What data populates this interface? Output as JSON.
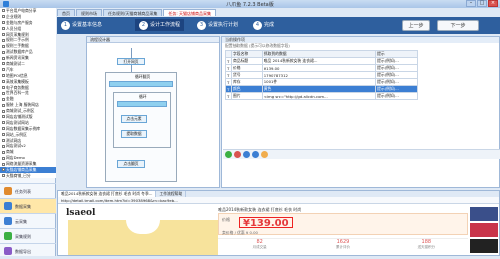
{
  "window": {
    "title": "八爪鱼 7.2.3 Beta版"
  },
  "tabs": [
    {
      "label": "首页",
      "active": false
    },
    {
      "label": "规则市场",
      "active": false
    },
    {
      "label": "任务规则/天猫商城商品采集",
      "active": false
    },
    {
      "label": "任务: 天猫店铺商品采集",
      "active": true
    }
  ],
  "wizard": {
    "steps": [
      {
        "num": "1",
        "label": "设置基本信息"
      },
      {
        "num": "2",
        "label": "设计工作流程"
      },
      {
        "num": "3",
        "label": "设置执行计划"
      },
      {
        "num": "4",
        "label": "完成"
      }
    ],
    "prev_label": "上一步",
    "next_label": "下一步"
  },
  "sidebar": {
    "tree": [
      "平台用户电商分享",
      "企业规则",
      "金融与房产服务",
      "人员分组",
      "网页采集规则",
      "规则二手示例",
      "规则三手数据",
      "测试数据库产品",
      "新闻资讯采集",
      "商城测试二",
      "汽车",
      "地图POI信息",
      "高效采集模板",
      "电子商务数据",
      "世界百科一览",
      "金融",
      "服装 上海 服装网店",
      "商城测试_示例区",
      "网店店铺测试版",
      "网店测试网站",
      "网店数据采集示例库",
      "网站_示例区",
      "测试网店",
      "网店测试v2",
      "商城",
      "网店Demo",
      "网络流量资源采集",
      "天猫店铺商品采集",
      "天猫商铺_已分",
      "天猫店铺商品采集_1"
    ],
    "selected_index": 27,
    "modules": [
      {
        "label": "任务列表",
        "active": false
      },
      {
        "label": "数据采集",
        "active": true
      },
      {
        "label": "云采集",
        "active": false
      },
      {
        "label": "采集规则",
        "active": false
      },
      {
        "label": "数据导出",
        "active": false
      }
    ]
  },
  "designer": {
    "header": "流程设计器",
    "nodes": {
      "open": "打开网页",
      "loop_page": "循环翻页",
      "loop": "循环",
      "click": "点击元素",
      "extract": "提取数据",
      "next": "点击翻页"
    }
  },
  "fields": {
    "header": "当前操作项",
    "sub": "配置抽取数据 (提示可以修改数据字段)",
    "columns": [
      "字段名称",
      "抓取到的数据",
      "提示"
    ],
    "rows": [
      [
        "商品标题",
        "唯品 2014秋新款女装 连衣裙...",
        "提示(例如)..."
      ],
      [
        "价格",
        "¥139.00",
        "提示(例如)..."
      ],
      [
        "货号",
        "1790787312",
        "提示(例如)..."
      ],
      [
        "库存",
        "1001件",
        "提示(例如)..."
      ],
      [
        "颜色",
        "黄色",
        "提示(例如)..."
      ],
      [
        "图片",
        "<img src=\"http://gd.alicdn.com...",
        "提示(例如)..."
      ]
    ],
    "selected_row": 4
  },
  "browser": {
    "tabs": [
      {
        "label": "唯品2014秋新款女装 连衣裙 打底衫 毛衣 时尚 冬季...",
        "active": true
      },
      {
        "label": "工作流程帮助",
        "active": false
      }
    ],
    "address": "http://detail.tmall.com/item.htm?id=39038968&rn=bac9eb...",
    "page": {
      "brand": "lsaeol",
      "title": "唯品2014秋新款女装 连衣裙 打底衫 毛衣 时尚",
      "price_label": "价格",
      "price": "¥139.00",
      "price_sub": "卖价格 / 优惠 ¥ 0.00",
      "stats": [
        {
          "n": "82",
          "l": "月成交量"
        },
        {
          "n": "1629",
          "l": "累计评价"
        },
        {
          "n": "188",
          "l": "送天猫积分"
        }
      ]
    }
  },
  "colors": {
    "wizard_bg": "#2e5f9e",
    "selection": "#3c7fd3",
    "price": "#e4393c"
  }
}
